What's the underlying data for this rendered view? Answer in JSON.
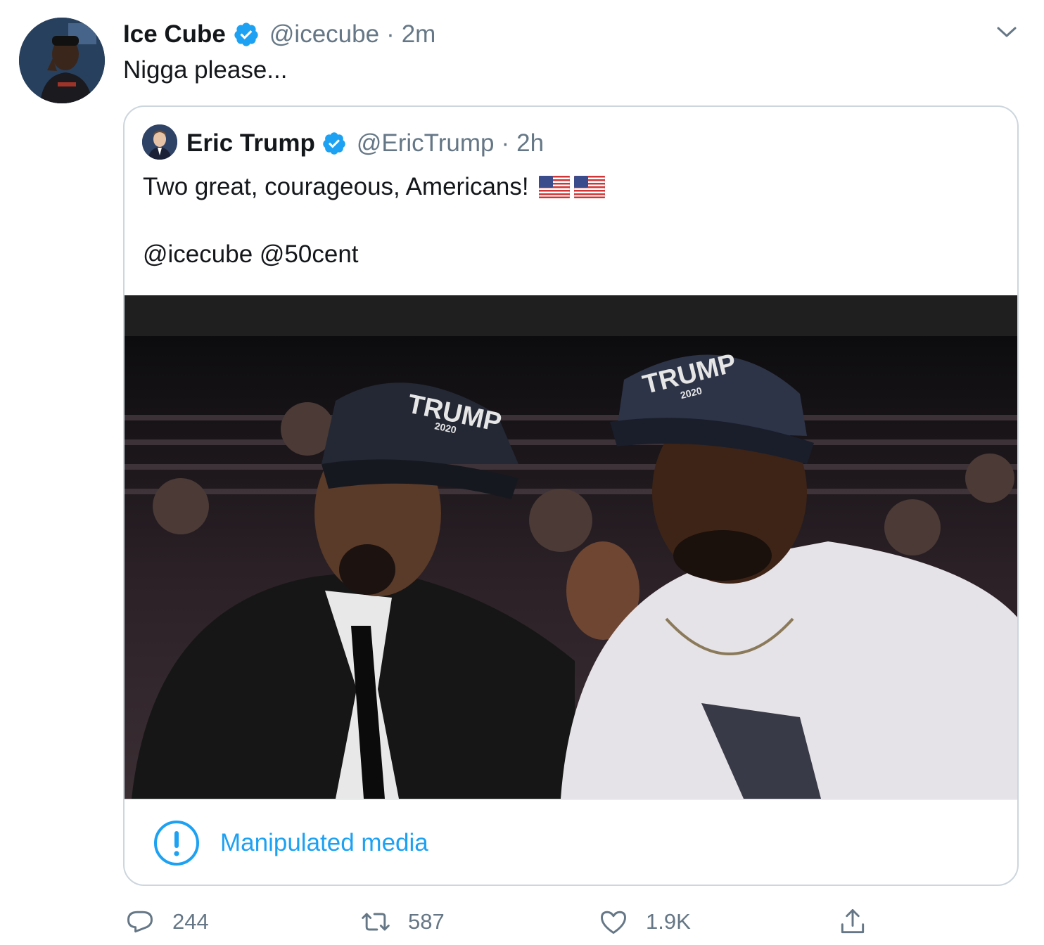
{
  "tweet": {
    "author_name": "Ice Cube",
    "handle": "@icecube",
    "separator": "·",
    "time": "2m",
    "text": "Nigga please..."
  },
  "quoted_tweet": {
    "author_name": "Eric Trump",
    "handle": "@EricTrump",
    "separator": "·",
    "time": "2h",
    "text_line1": "Two great, courageous, Americans!",
    "flags": [
      "us-flag-emoji",
      "us-flag-emoji"
    ],
    "text_line2": "@icecube @50cent",
    "media_notice": "Manipulated media"
  },
  "photo_text": {
    "cap_left": "TRUMP",
    "cap_left_year": "2020",
    "cap_right": "TRUMP",
    "cap_right_year": "2020"
  },
  "actions": {
    "replies": "244",
    "retweets": "587",
    "likes": "1.9K"
  },
  "icons": {
    "verified": "verified-badge-icon",
    "menu": "chevron-down-icon",
    "notice": "exclamation-circle-icon",
    "reply": "reply-icon",
    "retweet": "retweet-icon",
    "like": "heart-icon",
    "share": "share-icon"
  },
  "colors": {
    "accent": "#1da1f2",
    "secondary_text": "#657786",
    "primary_text": "#14171a",
    "border": "#ccd6dd"
  }
}
